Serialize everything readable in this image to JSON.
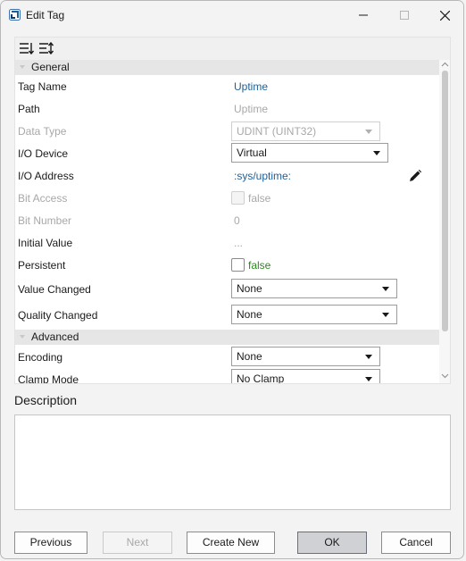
{
  "window": {
    "title": "Edit Tag",
    "app_icon": "app-logo-icon",
    "controls": [
      "minimize-icon",
      "maximize-icon",
      "close-icon"
    ]
  },
  "toolbar": {
    "sort_categorized_icon": "sort-categorized-icon",
    "sort_alphabetical_icon": "sort-alphabetical-icon"
  },
  "categories": {
    "general": "General",
    "advanced": "Advanced"
  },
  "properties": {
    "tag_name": {
      "label": "Tag Name",
      "value": "Uptime"
    },
    "path": {
      "label": "Path",
      "value": "Uptime"
    },
    "data_type": {
      "label": "Data Type",
      "value": "UDINT (UINT32)"
    },
    "io_device": {
      "label": "I/O Device",
      "value": "Virtual"
    },
    "io_address": {
      "label": "I/O Address",
      "value": ":sys/uptime:"
    },
    "bit_access": {
      "label": "Bit Access",
      "value": "false",
      "checked": false
    },
    "bit_number": {
      "label": "Bit Number",
      "value": "0"
    },
    "initial_value": {
      "label": "Initial Value",
      "value": "..."
    },
    "persistent": {
      "label": "Persistent",
      "value": "false",
      "checked": false
    },
    "value_changed": {
      "label": "Value Changed",
      "value": "None"
    },
    "quality_changed": {
      "label": "Quality Changed",
      "value": "None"
    },
    "encoding": {
      "label": "Encoding",
      "value": "None"
    },
    "clamp_mode": {
      "label": "Clamp Mode",
      "value": "No Clamp"
    }
  },
  "description": {
    "label": "Description",
    "value": ""
  },
  "buttons": {
    "previous": "Previous",
    "next": "Next",
    "create_new": "Create New",
    "ok": "OK",
    "cancel": "Cancel"
  },
  "colors": {
    "link_value": "#1f5f97",
    "false_value": "#2a8a1c",
    "disabled_text": "#a8a8a8",
    "category_bg": "#e6e6e6"
  }
}
